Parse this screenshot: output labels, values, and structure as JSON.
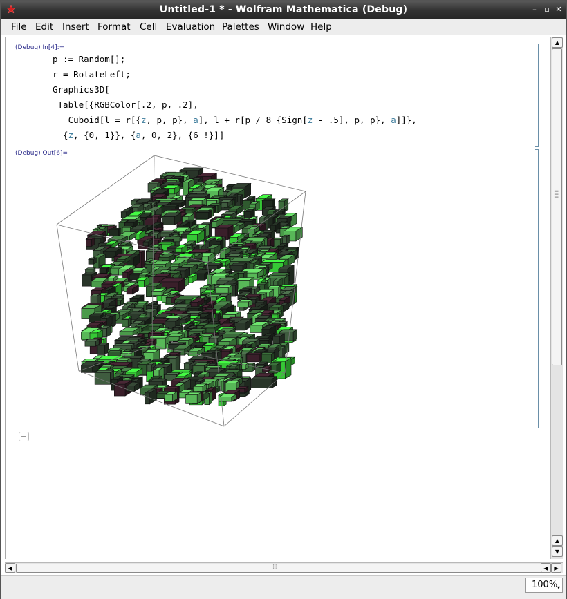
{
  "window": {
    "title": "Untitled-1 * - Wolfram Mathematica (Debug)",
    "buttons": {
      "minimize": "–",
      "maximize": "▫",
      "close": "✕"
    }
  },
  "menu": [
    "File",
    "Edit",
    "Insert",
    "Format",
    "Cell",
    "Evaluation",
    "Palettes",
    "Window",
    "Help"
  ],
  "notebook": {
    "input_label": "(Debug) In[4]:=",
    "output_label": "(Debug) Out[6]=",
    "code_lines": [
      "p := Random[];",
      "r = RotateLeft;",
      "Graphics3D[",
      " Table[{RGBColor[.2, p, .2],",
      "   Cuboid[l = r[{z, p, p}, a], l + r[p / 8 {Sign[z - .5], p, p}, a]]},",
      "  {z, {0, 1}}, {a, 0, 2}, {6 !}]]"
    ],
    "insert_button": "+"
  },
  "colors": {
    "dark_green": "#2f4a2f",
    "mid_green": "#3b7a3b",
    "bright_green": "#3fd43f",
    "maroon": "#3a1f2a"
  },
  "icons": [
    "mathematica-app-icon",
    "scroll-up-icon",
    "scroll-down-icon",
    "scroll-left-icon",
    "scroll-right-icon"
  ],
  "status": {
    "zoom": "100%"
  }
}
